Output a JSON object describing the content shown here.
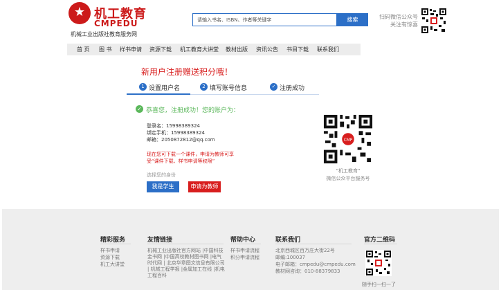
{
  "header": {
    "logo_title": "机工教育",
    "logo_sub": "CMPEDU",
    "logo_caption": "机械工业出版社教育服务网",
    "search_placeholder": "请输入书名、ISBN、作者等关键字",
    "search_button": "搜索",
    "scan_line1": "扫码微信公众号",
    "scan_line2": "关注有惊喜"
  },
  "nav": [
    "首 页",
    "图 书",
    "样书申请",
    "资源下载",
    "机工教育大讲堂",
    "教材出版",
    "资讯公告",
    "书目下载",
    "联系我们"
  ],
  "promo": "新用户注册赠送积分哦！",
  "steps": [
    {
      "num": "1",
      "label": "设置用户名"
    },
    {
      "num": "2",
      "label": "填写账号信息"
    },
    {
      "num": "✓",
      "label": "注册成功"
    }
  ],
  "success": {
    "message": "恭喜您，注册成功！您的账户为：",
    "login_name": "登录名：15998389324",
    "phone": "绑定手机：15998389324",
    "email": "邮箱：2050872812@qq.com",
    "notice_line1": "现在您可下载一个课件，申请为教师可享",
    "notice_line2": "受“课件下载、样书申请等权限”",
    "choose_label": "选择您的身份",
    "student_button": "我是学生",
    "teacher_button": "申请为教师",
    "qr_caption1": "“机工教育”",
    "qr_caption2": "微信公众平台服务号"
  },
  "footer": {
    "col1_title": "精彩服务",
    "col1_links": [
      "样书申请",
      "资源下载",
      "机工大讲堂"
    ],
    "col2_title": "友情链接",
    "col2_lines": [
      "机械工业出版社官方网站 |中国科技",
      "金书网 |中国高校教材图书网 |电气",
      "时代网 | 北京华章图文信息有限公司",
      "| 机械工程学报 |金属加工在线 |机电",
      "工程百科"
    ],
    "col3_title": "帮助中心",
    "col3_links": [
      "样书申请流程",
      "积分申请流程"
    ],
    "col4_title": "联系我们",
    "col4_lines": [
      "北京西城区百万庄大街22号",
      "邮编:100037",
      "电子邮箱：cmpedu@cmpedu.com",
      "教材网咨询：010-88379833"
    ],
    "col5_title": "官方二维码",
    "col5_caption": "随手扫一扫一了"
  }
}
